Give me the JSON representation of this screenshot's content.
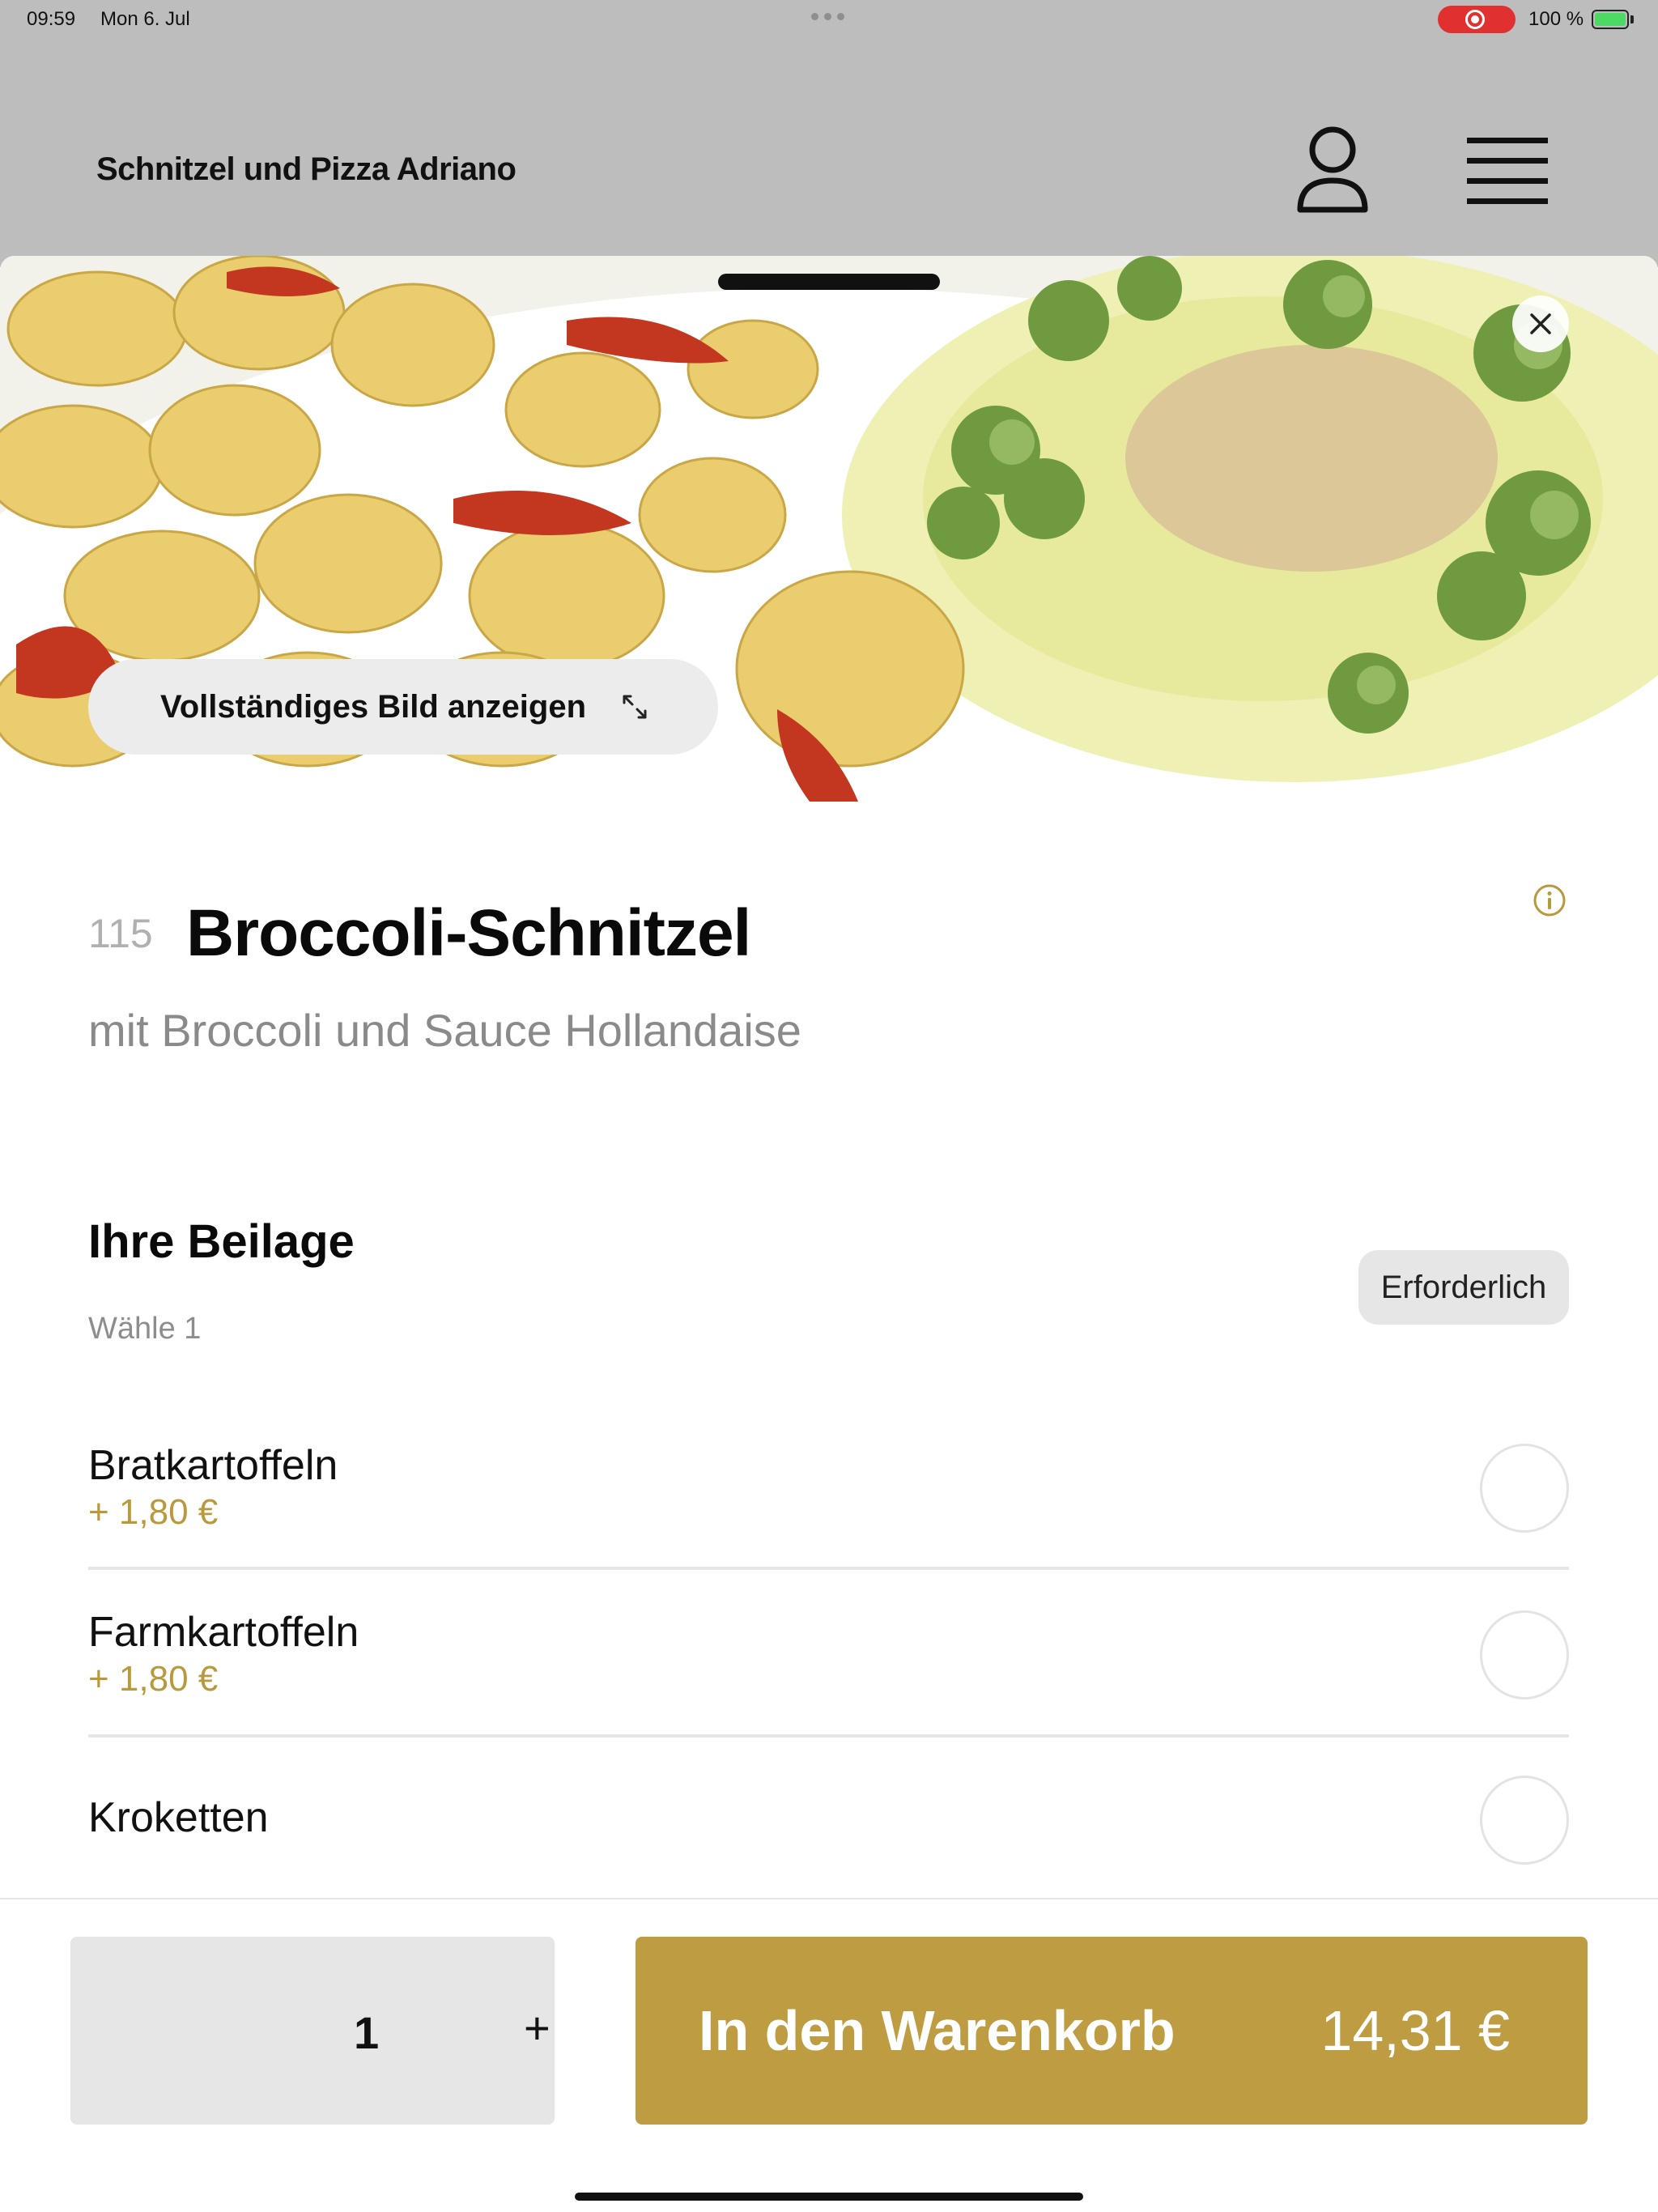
{
  "status_bar": {
    "time": "09:59",
    "date": "Mon 6. Jul",
    "battery": "100 %",
    "battery_level": 1.0
  },
  "header": {
    "restaurant_name": "Schnitzel und Pizza Adriano",
    "icons": [
      "user-icon",
      "hamburger-menu-icon"
    ]
  },
  "hero": {
    "view_full_image_label": "Vollständiges Bild anzeigen",
    "icons": [
      "close-icon",
      "expand-icon"
    ]
  },
  "item": {
    "number": "115",
    "name": "Broccoli-Schnitzel",
    "description": "mit Broccoli und Sauce Hollandaise"
  },
  "side_dish_section": {
    "title": "Ihre Beilage",
    "subtitle": "Wähle 1",
    "required_label": "Erforderlich",
    "options": [
      {
        "name": "Bratkartoffeln",
        "price": "+ 1,80 €",
        "selected": false
      },
      {
        "name": "Farmkartoffeln",
        "price": "+ 1,80 €",
        "selected": false
      },
      {
        "name": "Kroketten",
        "price": "",
        "selected": false
      }
    ]
  },
  "cart": {
    "quantity": "1",
    "plus_label": "+",
    "add_label": "In den Warenkorb",
    "total": "14,31 €"
  },
  "colors": {
    "accent": "#bd9c42",
    "price": "#b8993d",
    "dim_background": "#bdbdbd",
    "recording": "#e0302f"
  }
}
